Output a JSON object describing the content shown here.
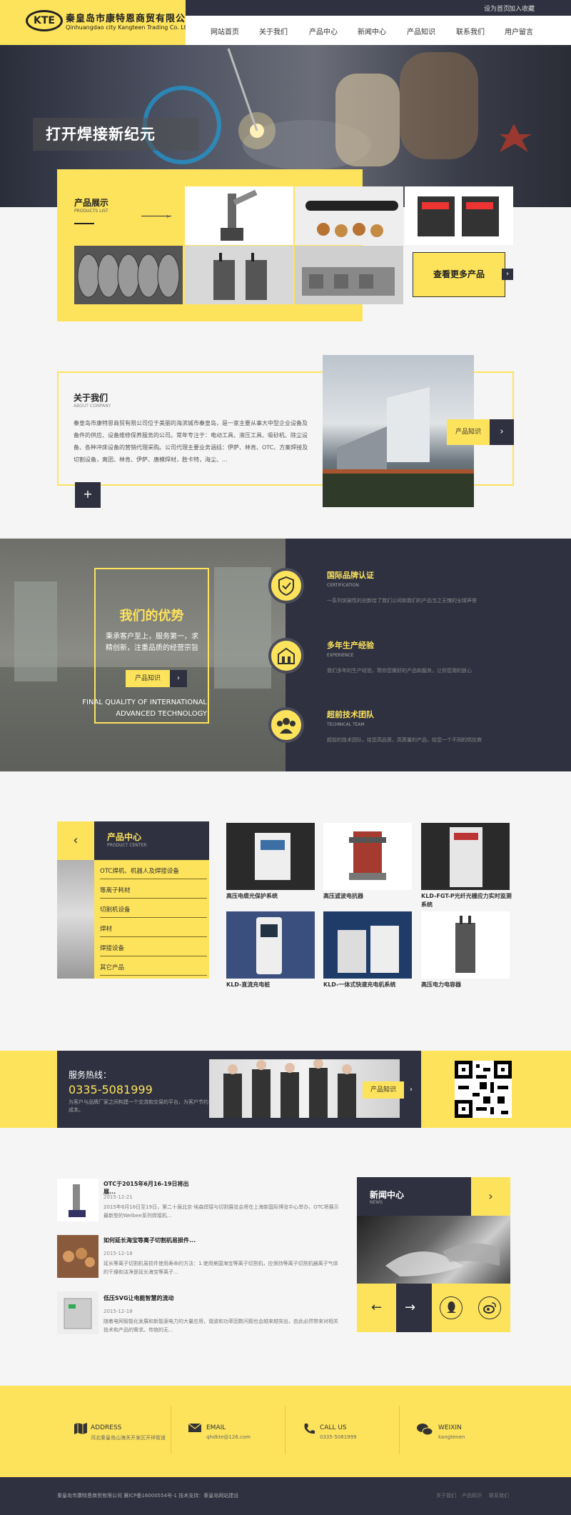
{
  "header": {
    "logo_mark": "KTE",
    "company_cn": "秦皇岛市康特恩商贸有限公司",
    "company_en": "Qinhuangdao city Kangteen Trading Co. Ltd.",
    "top_links": [
      "设为首页",
      "加入收藏"
    ],
    "nav": [
      "网站首页",
      "关于我们",
      "产品中心",
      "新闻中心",
      "产品知识",
      "联系我们",
      "用户留言"
    ]
  },
  "hero": {
    "slogan": "打开焊接新纪元"
  },
  "products_showcase": {
    "title": "产品展示",
    "subtitle": "PRODUCTS LIST",
    "more": "查看更多产品",
    "arrow": "›"
  },
  "about": {
    "title": "关于我们",
    "subtitle": "ABOUT COMPANY",
    "text": "秦皇岛市康特恩商贸有限公司位于美丽的海滨城市秦皇岛，是一家主要从事大中型企业设备及备件的供应、设备维修保养服务的公司。常年专注于：电动工具、液压工具、吸砂机、除尘设备、各种冲床设备的营销代理采购。公司代理主要业务涵括：伊萨、林肯、OTC、方案焊接及切割设备，离团、林肯、伊萨、唐模焊材，胜卡特，海尘、...",
    "plus": "+",
    "knowledge_btn": "产品知识",
    "arrow": "›"
  },
  "advantages": {
    "title": "我们的优势",
    "text": "秉承客户至上，服务第一，求精创新，注重品质的经营宗旨",
    "btn": "产品知识",
    "arrow": "›",
    "en_line1": "FINAL QUALITY OF INTERNATIONAL",
    "en_line2": "ADVANCED TECHNOLOGY",
    "items": [
      {
        "title": "国际品牌认证",
        "en": "CERTIFICATION",
        "desc": "一系列突破性的创新给了我们公司和我们的产品当之无愧的全球声誉"
      },
      {
        "title": "多年生产经验",
        "en": "EXPERIENCE",
        "desc": "我们多年的生产经验，帮你您做好的产品和服务，让你您用的放心"
      },
      {
        "title": "超前技术团队",
        "en": "TECHNICAL TEAM",
        "desc": "超前的技术团队，给您高品质，高质量的产品，给您一个不同的供应商"
      }
    ]
  },
  "product_center": {
    "back": "‹",
    "title": "产品中心",
    "subtitle": "PRODUCT CENTER",
    "categories": [
      "OTC焊机、机器人及焊接设备",
      "等离子耗材",
      "切割机设备",
      "焊材",
      "焊接设备",
      "其它产品"
    ],
    "cards": [
      "高压电缆光保护系统",
      "高压滤波电抗器",
      "KLD-FGT-P光纤光栅应力实时监测系统",
      "KLD-直流充电桩",
      "KLD-一体式快速充电机系统",
      "高压电力电容器"
    ]
  },
  "hotline": {
    "label": "服务热线：",
    "number": "0335-5081999",
    "desc": "为客户与品牌厂家之间构建一个交流和交易的平台，为客户节约成本。",
    "btn": "产品知识",
    "arrow": "›"
  },
  "news": {
    "items": [
      {
        "title": "OTC于2015年6月16-19日将出展...",
        "date": "2015-12-21",
        "desc": "2015年6月16日至19日，第二十届北京·埃森焊接与切割展览会将在上海新国际博览中心举办，OTC将展示最新型的Welbee系列焊接机..."
      },
      {
        "title": "如何延长海宝等离子切割机易损件...",
        "date": "2015-12-18",
        "desc": "延长等离子切割机易损件使用寿命的方法：1.使用美国海宝等离子切割机，应保持等离子切割机器离子气体的干燥和洁净是延长海宝等离子..."
      },
      {
        "title": "低压SVG让电能智慧的流动",
        "date": "2015-12-18",
        "desc": "随着电网智能化发展和新能源电力的大量应用，谐波和功率因数问题也会越来越突出，由此必然带来对相关技术和产品的需求。传统的无..."
      }
    ],
    "center_title": "新闻中心",
    "center_sub": "NEWS",
    "center_arrow": "›",
    "prev": "←",
    "next": "→"
  },
  "footer": {
    "contacts": [
      {
        "title": "ADDRESS",
        "value": "河北秦皇岛山海关开发区开祥街道"
      },
      {
        "title": "EMAIL",
        "value": "qhdkte@126.com"
      },
      {
        "title": "CALL US",
        "value": "0335-5081999"
      },
      {
        "title": "WEIXIN",
        "value": "kangtenen"
      }
    ],
    "copyright": "秦皇岛市康特恩商贸有限公司  冀ICP备16000554号-1  技术支持：秦皇岛网站建设",
    "links": [
      "关于我们",
      "产品知识",
      "联系我们"
    ]
  },
  "colors": {
    "accent": "#fde35c",
    "dark": "#2f3140"
  }
}
